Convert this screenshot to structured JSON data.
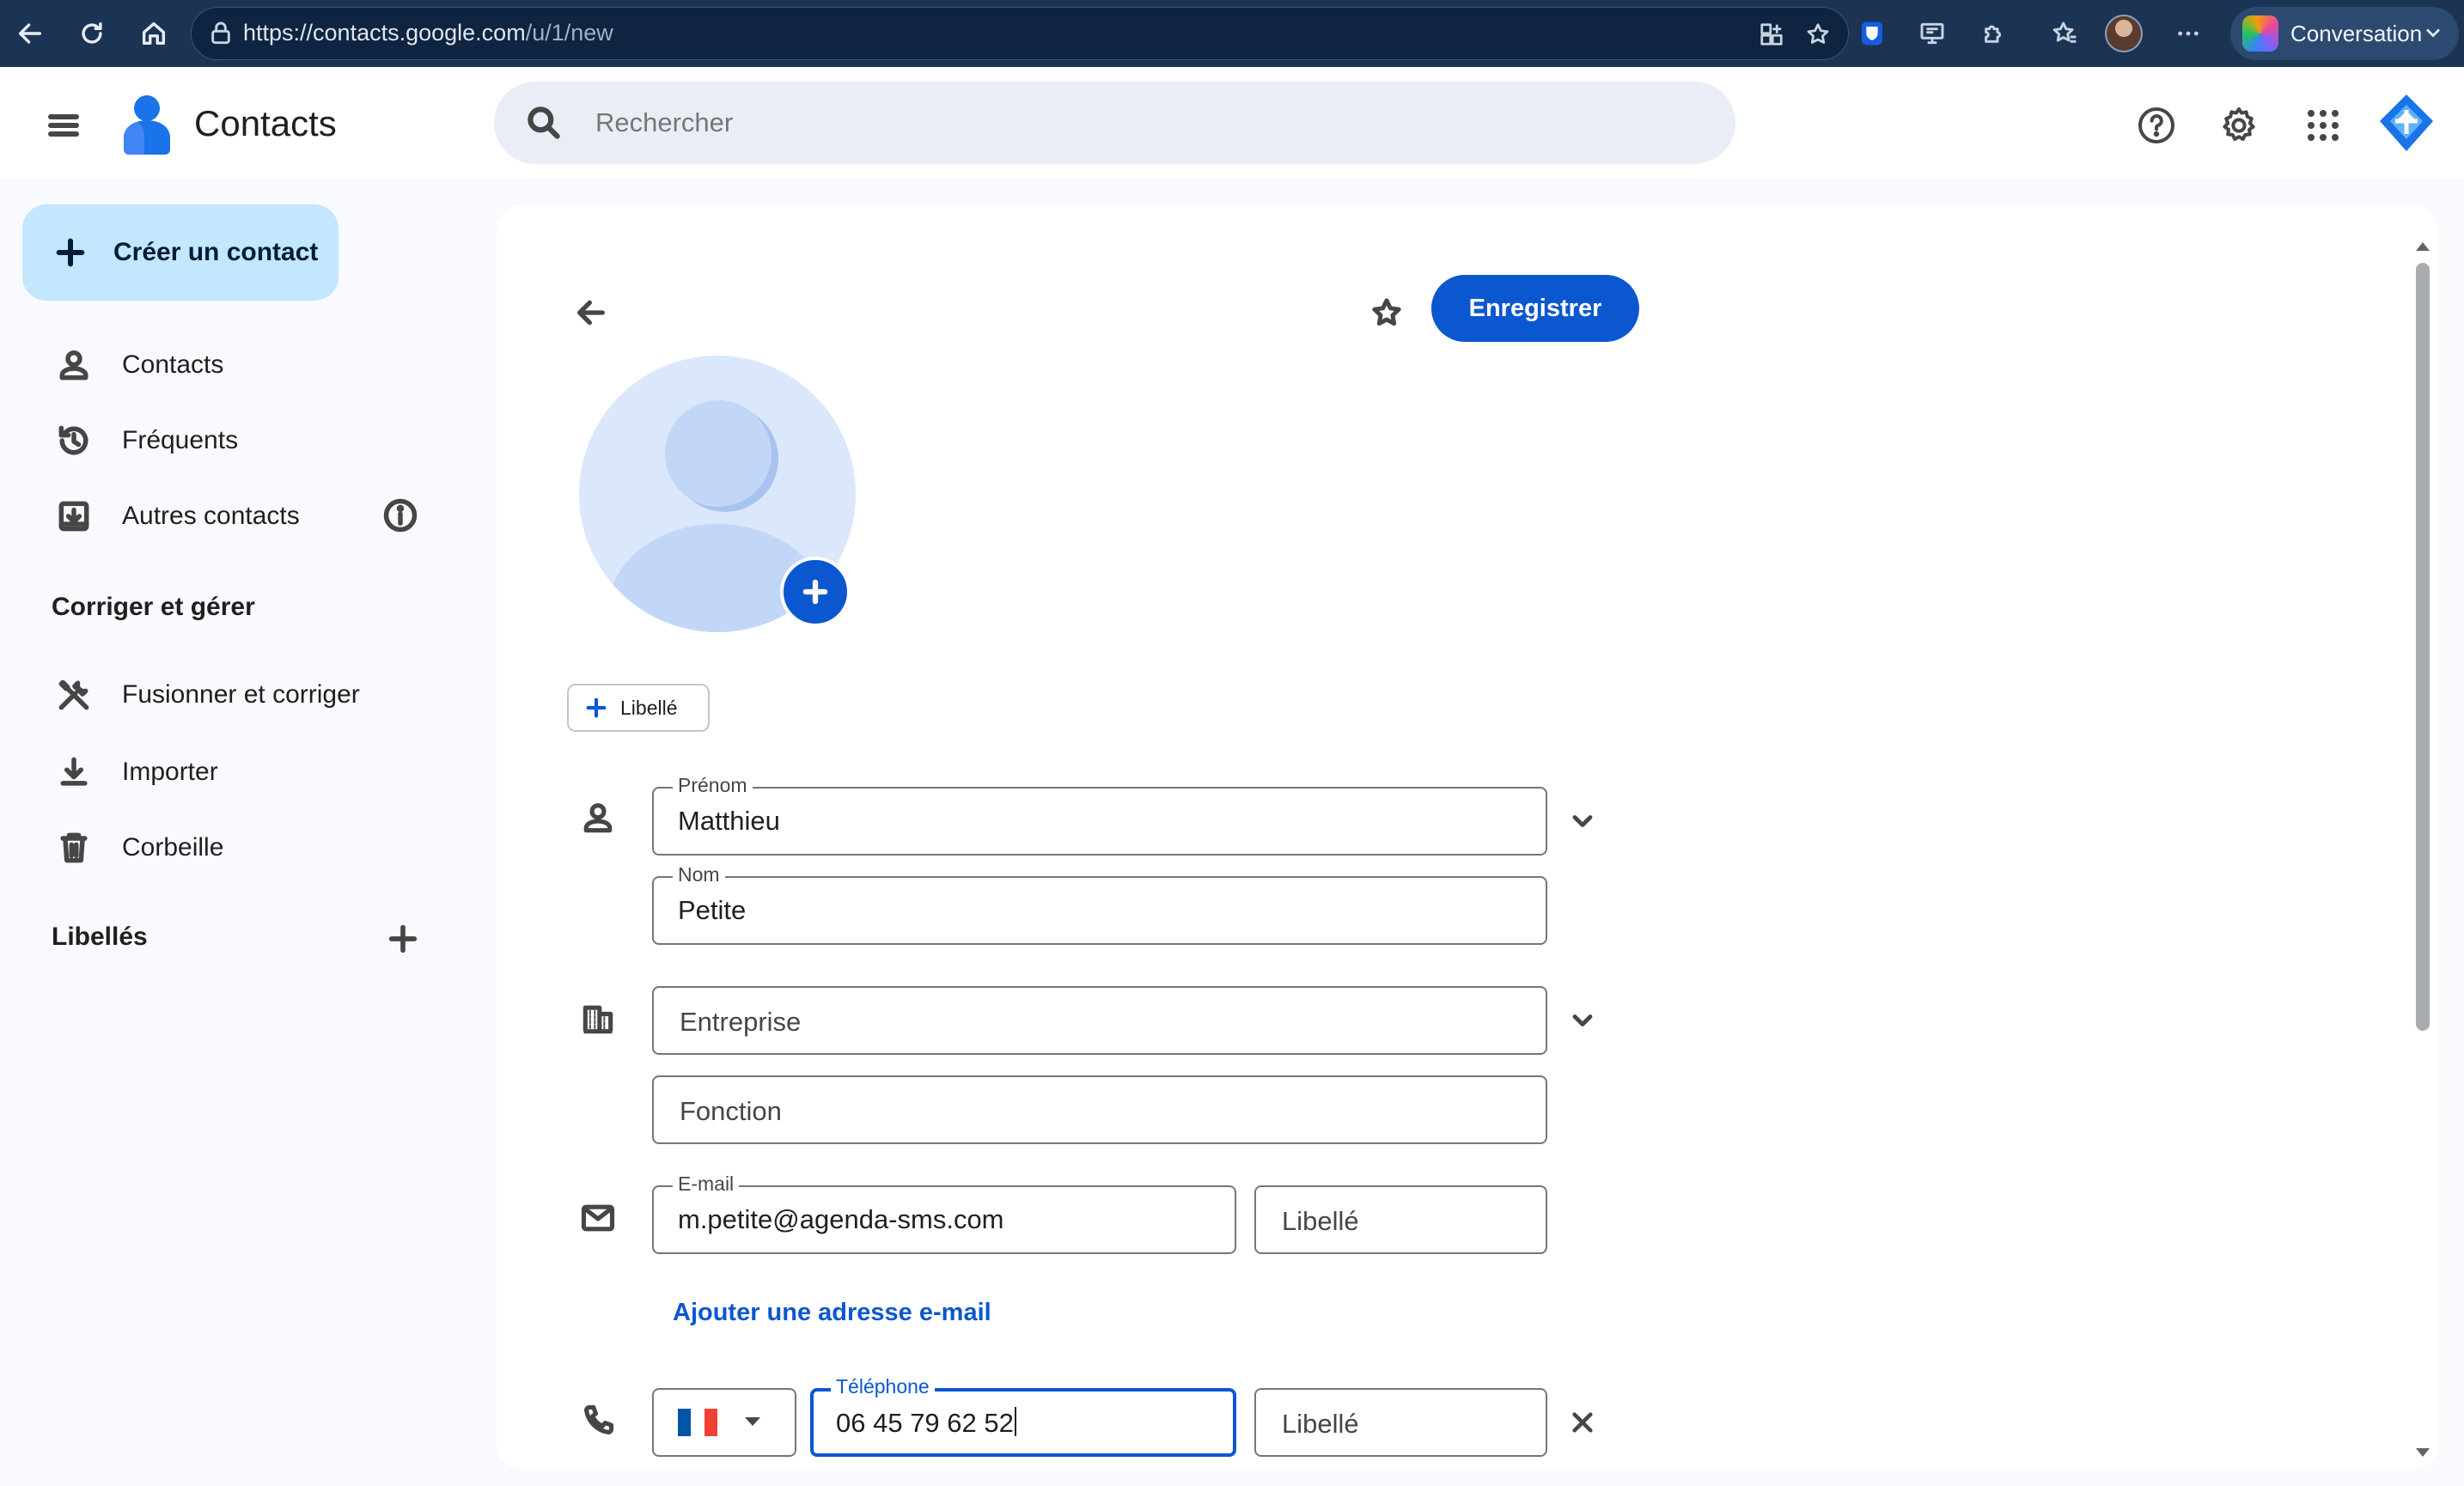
{
  "browser": {
    "url_host": "https://contacts.google.com",
    "url_path": "/u/1/new",
    "copilot_label": "Conversation"
  },
  "header": {
    "app_title": "Contacts",
    "search_placeholder": "Rechercher"
  },
  "sidebar": {
    "create_label": "Créer un contact",
    "items": [
      {
        "label": "Contacts",
        "icon": "person-icon"
      },
      {
        "label": "Fréquents",
        "icon": "history-icon"
      },
      {
        "label": "Autres contacts",
        "icon": "archive-icon"
      }
    ],
    "manage_title": "Corriger et gérer",
    "manage_items": [
      {
        "label": "Fusionner et corriger",
        "icon": "tools-icon"
      },
      {
        "label": "Importer",
        "icon": "download-icon"
      },
      {
        "label": "Corbeille",
        "icon": "trash-icon"
      }
    ],
    "labels_title": "Libellés"
  },
  "form": {
    "save_label": "Enregistrer",
    "label_chip": "Libellé",
    "first_name": {
      "label": "Prénom",
      "value": "Matthieu"
    },
    "last_name": {
      "label": "Nom",
      "value": "Petite"
    },
    "company": {
      "placeholder": "Entreprise"
    },
    "job_title": {
      "placeholder": "Fonction"
    },
    "email": {
      "label": "E-mail",
      "value": "m.petite@agenda-sms.com",
      "tag_placeholder": "Libellé"
    },
    "add_email_label": "Ajouter une adresse e-mail",
    "phone": {
      "label": "Téléphone",
      "value": "06 45 79 62 52",
      "tag_placeholder": "Libellé",
      "country_flag_colors": [
        "#0055a4",
        "#ffffff",
        "#ef4135"
      ]
    }
  },
  "colors": {
    "primary": "#0b57d0",
    "create_button_bg": "#c2e7ff",
    "browser_bar": "#1c3454"
  }
}
